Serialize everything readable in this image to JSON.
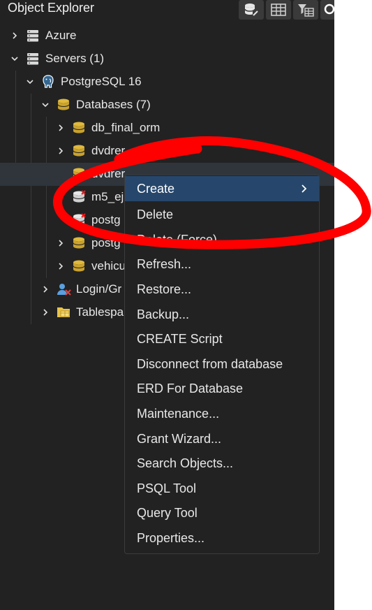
{
  "panel": {
    "title": "Object Explorer",
    "toolbar": [
      {
        "icon": "database-stack-icon"
      },
      {
        "icon": "table-grid-icon"
      },
      {
        "icon": "filtered-rows-icon"
      },
      {
        "icon": "search-icon"
      }
    ]
  },
  "tree": [
    {
      "label": "Azure",
      "icon": "server-group-icon",
      "expanded": false
    },
    {
      "label": "Servers (1)",
      "icon": "server-group-icon",
      "expanded": true
    },
    {
      "label": "PostgreSQL 16",
      "icon": "postgres-elephant-icon",
      "expanded": true
    },
    {
      "label": "Databases (7)",
      "icon": "databases-icon",
      "expanded": true
    },
    {
      "label": "db_final_orm",
      "icon": "database-icon",
      "expanded": false
    },
    {
      "label": "dvdrer",
      "icon": "database-icon",
      "expanded": false
    },
    {
      "label": "dvdrer",
      "icon": "database-icon",
      "expanded": false,
      "selected": true
    },
    {
      "label": "m5_ej",
      "icon": "database-disconnected-icon",
      "expanded": false
    },
    {
      "label": "postg",
      "icon": "database-disconnected-icon",
      "expanded": false
    },
    {
      "label": "postg",
      "icon": "database-icon",
      "expanded": false
    },
    {
      "label": "vehicu",
      "icon": "database-icon",
      "expanded": false
    },
    {
      "label": "Login/Gr",
      "icon": "login-group-roles-icon",
      "expanded": false
    },
    {
      "label": "Tablespa",
      "icon": "tablespaces-folder-icon",
      "expanded": false
    }
  ],
  "context_menu": {
    "items": [
      {
        "label": "Create",
        "has_submenu": true,
        "highlighted": true
      },
      {
        "label": "Delete"
      },
      {
        "label": "Delete (Force)"
      },
      {
        "label": "Refresh..."
      },
      {
        "label": "Restore..."
      },
      {
        "label": "Backup..."
      },
      {
        "label": "CREATE Script"
      },
      {
        "label": "Disconnect from database"
      },
      {
        "label": "ERD For Database"
      },
      {
        "label": "Maintenance..."
      },
      {
        "label": "Grant Wizard..."
      },
      {
        "label": "Search Objects..."
      },
      {
        "label": "PSQL Tool"
      },
      {
        "label": "Query Tool"
      },
      {
        "label": "Properties..."
      }
    ]
  },
  "colors": {
    "panel_bg": "#222222",
    "selected_row": "#2f353b",
    "menu_highlight": "#26476b",
    "db_icon_gold": "#e0b93c",
    "annotation_red": "#ff0000"
  }
}
